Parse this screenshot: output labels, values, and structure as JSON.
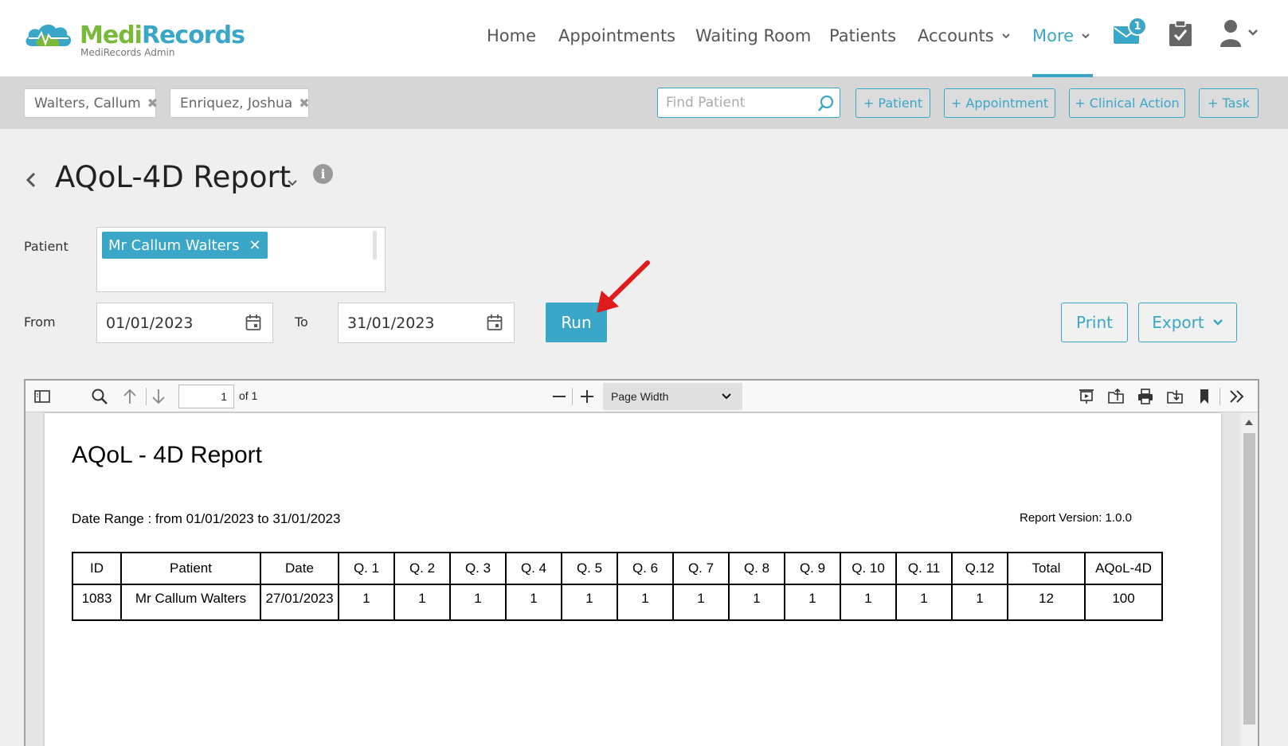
{
  "brand": {
    "name_part1": "Medi",
    "name_part2": "Records",
    "subtitle": "MediRecords Admin"
  },
  "nav": {
    "items": [
      {
        "label": "Home"
      },
      {
        "label": "Appointments"
      },
      {
        "label": "Waiting Room"
      },
      {
        "label": "Patients"
      },
      {
        "label": "Accounts"
      },
      {
        "label": "More"
      }
    ],
    "active": "More",
    "mail_badge": "1"
  },
  "patient_tabs": [
    {
      "label": "Walters, Callum"
    },
    {
      "label": "Enriquez, Joshua"
    }
  ],
  "quick": {
    "find_placeholder": "Find Patient",
    "buttons": [
      "+ Patient",
      "+ Appointment",
      "+ Clinical Action",
      "+ Task"
    ]
  },
  "page": {
    "title": "AQoL-4D Report",
    "info": "i"
  },
  "form": {
    "patient_label": "Patient",
    "patient_chip": "Mr Callum Walters",
    "from_label": "From",
    "from_value": "01/01/2023",
    "to_label": "To",
    "to_value": "31/01/2023",
    "run_label": "Run",
    "print_label": "Print",
    "export_label": "Export"
  },
  "viewer": {
    "page_number": "1",
    "page_of": "of 1",
    "zoom": "Page Width"
  },
  "report": {
    "title": "AQoL - 4D Report",
    "date_range": "Date Range : from 01/01/2023 to 31/01/2023",
    "version": "Report Version: 1.0.0",
    "columns": [
      "ID",
      "Patient",
      "Date",
      "Q. 1",
      "Q. 2",
      "Q. 3",
      "Q. 4",
      "Q. 5",
      "Q. 6",
      "Q. 7",
      "Q. 8",
      "Q. 9",
      "Q. 10",
      "Q. 11",
      "Q.12",
      "Total",
      "AQoL-4D"
    ],
    "rows": [
      [
        "1083",
        "Mr Callum Walters",
        "27/01/2023",
        "1",
        "1",
        "1",
        "1",
        "1",
        "1",
        "1",
        "1",
        "1",
        "1",
        "1",
        "1",
        "12",
        "100"
      ]
    ]
  },
  "colors": {
    "accent": "#3aa7c9",
    "brand_green": "#7ab93a",
    "annotation_arrow": "#e01b1b"
  }
}
